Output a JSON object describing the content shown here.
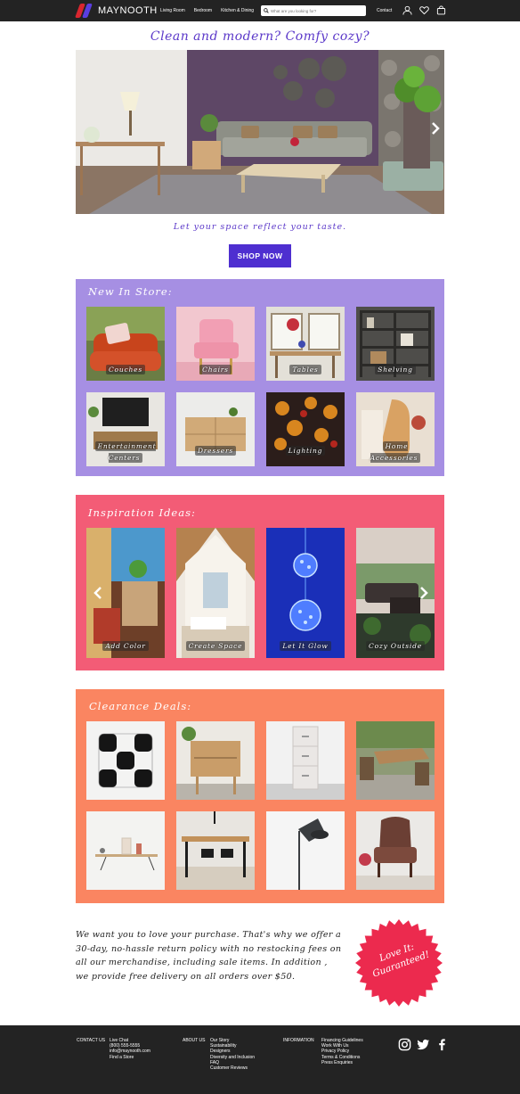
{
  "nav": {
    "brand": "MAYNOOTH",
    "links": [
      "Living Room",
      "Bedroom",
      "Kitchen & Dining"
    ],
    "search_placeholder": "What are you looking for?",
    "contact": "Contact"
  },
  "hero": {
    "tagline": "Clean and modern? Comfy cozy?",
    "subtagline": "Let your space reflect your taste.",
    "cta": "SHOP NOW"
  },
  "new_in_store": {
    "title": "New In Store:",
    "items": [
      "Couches",
      "Chairs",
      "Tables",
      "Shelving",
      "Entertainment Centers",
      "Dressers",
      "Lighting",
      "Home Accessories"
    ]
  },
  "inspiration": {
    "title": "Inspiration Ideas:",
    "items": [
      "Add Color",
      "Create Space",
      "Let It Glow",
      "Cozy Outside"
    ]
  },
  "clearance": {
    "title": "Clearance Deals:"
  },
  "promise": {
    "text": "We want you to love your purchase. That's why we offer a 30-day, no-hassle return policy with no restocking fees on all our merchandise, including sale items. In addition , we provide free delivery on all orders over $50.",
    "badge": "Love It: Guaranteed!"
  },
  "footer": {
    "contact_heading": "CONTACT US",
    "contact_items": [
      "Live Chat",
      "(800) 555-5555",
      "info@maynooth.com",
      "Find a Store"
    ],
    "about_heading": "ABOUT US",
    "about_items": [
      "Our Story",
      "Sustainability",
      "Designers",
      "Diversity and Inclusion",
      "FAQ",
      "Customer Reviews"
    ],
    "info_heading": "INFORMATION",
    "info_items": [
      "Financing Guidelines",
      "Work With Us",
      "Privacy Policy",
      "Terms & Conditions",
      "Press Enquiries"
    ]
  },
  "colors": {
    "nav_bg": "#232323",
    "accent": "#4e2fd0",
    "new_in_store_bg": "#a68fe3",
    "inspiration_bg": "#f35c76",
    "clearance_bg": "#fa8561",
    "badge": "#ec2a4e"
  }
}
